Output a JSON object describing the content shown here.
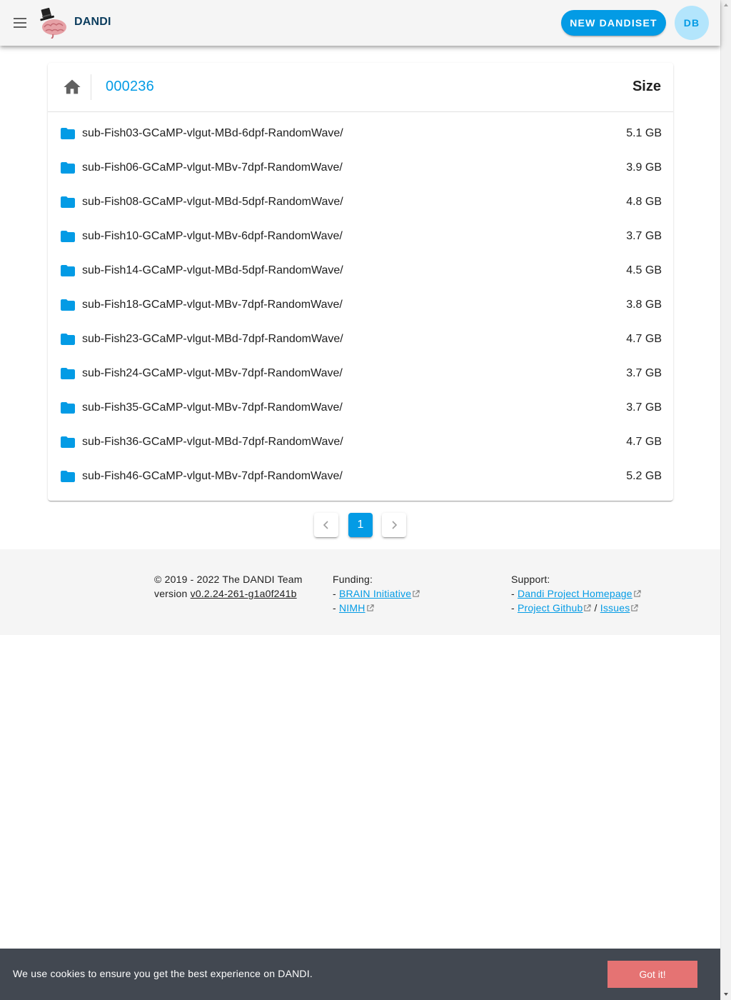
{
  "appbar": {
    "brand": "DANDI",
    "new_button": "NEW DANDISET",
    "avatar_initials": "DB",
    "accent_color": "#039be5"
  },
  "browser": {
    "breadcrumb": "000236",
    "size_header": "Size",
    "rows": [
      {
        "name": "sub-Fish03-GCaMP-vlgut-MBd-6dpf-RandomWave/",
        "size": "5.1 GB"
      },
      {
        "name": "sub-Fish06-GCaMP-vlgut-MBv-7dpf-RandomWave/",
        "size": "3.9 GB"
      },
      {
        "name": "sub-Fish08-GCaMP-vlgut-MBd-5dpf-RandomWave/",
        "size": "4.8 GB"
      },
      {
        "name": "sub-Fish10-GCaMP-vlgut-MBv-6dpf-RandomWave/",
        "size": "3.7 GB"
      },
      {
        "name": "sub-Fish14-GCaMP-vlgut-MBd-5dpf-RandomWave/",
        "size": "4.5 GB"
      },
      {
        "name": "sub-Fish18-GCaMP-vlgut-MBv-7dpf-RandomWave/",
        "size": "3.8 GB"
      },
      {
        "name": "sub-Fish23-GCaMP-vlgut-MBd-7dpf-RandomWave/",
        "size": "4.7 GB"
      },
      {
        "name": "sub-Fish24-GCaMP-vlgut-MBv-7dpf-RandomWave/",
        "size": "3.7 GB"
      },
      {
        "name": "sub-Fish35-GCaMP-vlgut-MBv-7dpf-RandomWave/",
        "size": "3.7 GB"
      },
      {
        "name": "sub-Fish36-GCaMP-vlgut-MBd-7dpf-RandomWave/",
        "size": "4.7 GB"
      },
      {
        "name": "sub-Fish46-GCaMP-vlgut-MBv-7dpf-RandomWave/",
        "size": "5.2 GB"
      }
    ],
    "folder_icon": "folder-icon",
    "folder_color": "#039be5"
  },
  "pagination": {
    "current_page": "1"
  },
  "footer": {
    "copyright": "© 2019 - 2022 The DANDI Team",
    "version_prefix": "version ",
    "version": "v0.2.24-261-g1a0f241b",
    "funding_label": "Funding:",
    "funding_links": [
      "BRAIN Initiative",
      "NIMH"
    ],
    "support_label": "Support:",
    "support_homepage": "Dandi Project Homepage",
    "support_github": "Project Github",
    "support_separator": " / ",
    "support_issues": "Issues",
    "dash": "- "
  },
  "cookie": {
    "text": "We use cookies to ensure you get the best experience on DANDI.",
    "button": "Got it!",
    "banner_color": "#424851",
    "button_color": "#e57373"
  }
}
